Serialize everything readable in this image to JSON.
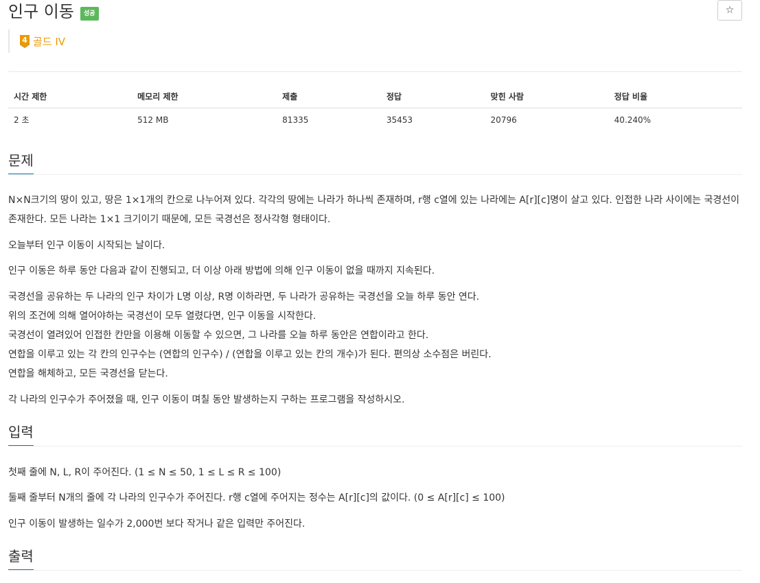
{
  "header": {
    "title": "인구 이동",
    "result_badge": "성공",
    "star_label": "☆"
  },
  "tier": {
    "number": "4",
    "label": "골드 IV",
    "color": "#ec9a00"
  },
  "info_table": {
    "headers": [
      "시간 제한",
      "메모리 제한",
      "제출",
      "정답",
      "맞힌 사람",
      "정답 비율"
    ],
    "values": [
      "2 초",
      "512 MB",
      "81335",
      "35453",
      "20796",
      "40.240%"
    ]
  },
  "problem": {
    "heading": "문제",
    "p1": "N×N크기의 땅이 있고, 땅은 1×1개의 칸으로 나누어져 있다. 각각의 땅에는 나라가 하나씩 존재하며, r행 c열에 있는 나라에는 A[r][c]명이 살고 있다. 인접한 나라 사이에는 국경선이 존재한다. 모든 나라는 1×1 크기이기 때문에, 모든 국경선은 정사각형 형태이다.",
    "p2": "오늘부터 인구 이동이 시작되는 날이다.",
    "p3": "인구 이동은 하루 동안 다음과 같이 진행되고, 더 이상 아래 방법에 의해 인구 이동이 없을 때까지 지속된다.",
    "steps": [
      "국경선을 공유하는 두 나라의 인구 차이가 L명 이상, R명 이하라면, 두 나라가 공유하는 국경선을 오늘 하루 동안 연다.",
      "위의 조건에 의해 열어야하는 국경선이 모두 열렸다면, 인구 이동을 시작한다.",
      "국경선이 열려있어 인접한 칸만을 이용해 이동할 수 있으면, 그 나라를 오늘 하루 동안은 연합이라고 한다.",
      "연합을 이루고 있는 각 칸의 인구수는 (연합의 인구수) / (연합을 이루고 있는 칸의 개수)가 된다. 편의상 소수점은 버린다.",
      "연합을 해체하고, 모든 국경선을 닫는다."
    ],
    "p4": "각 나라의 인구수가 주어졌을 때, 인구 이동이 며칠 동안 발생하는지 구하는 프로그램을 작성하시오."
  },
  "input": {
    "heading": "입력",
    "p1": "첫째 줄에 N, L, R이 주어진다. (1 ≤ N ≤ 50, 1 ≤ L ≤ R ≤ 100)",
    "p2": "둘째 줄부터 N개의 줄에 각 나라의 인구수가 주어진다. r행 c열에 주어지는 정수는 A[r][c]의 값이다. (0 ≤ A[r][c] ≤ 100)",
    "p3": "인구 이동이 발생하는 일수가 2,000번 보다 작거나 같은 입력만 주어진다."
  },
  "output": {
    "heading": "출력"
  }
}
